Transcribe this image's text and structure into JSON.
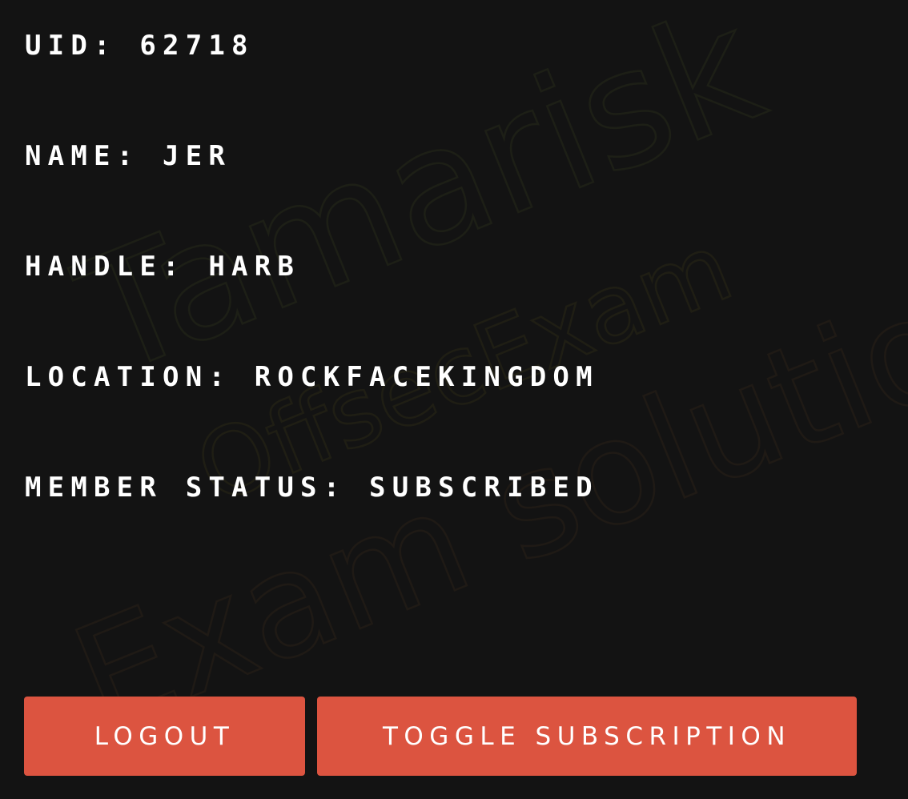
{
  "profile": {
    "uid": "UID: 62718",
    "name": "NAME: JER",
    "handle": "HANDLE: HARB",
    "location": "LOCATION: ROCKFACEKINGDOM",
    "member_status": "MEMBER STATUS: SUBSCRIBED"
  },
  "actions": {
    "logout_label": "LOGOUT",
    "toggle_label": "TOGGLE SUBSCRIPTION"
  },
  "watermark": {
    "line1": "Tamarisk",
    "line2": "OffsecExam",
    "line3": "Exam solution"
  },
  "colors": {
    "background": "#131313",
    "text": "#ffffff",
    "button": "#dc5440"
  }
}
